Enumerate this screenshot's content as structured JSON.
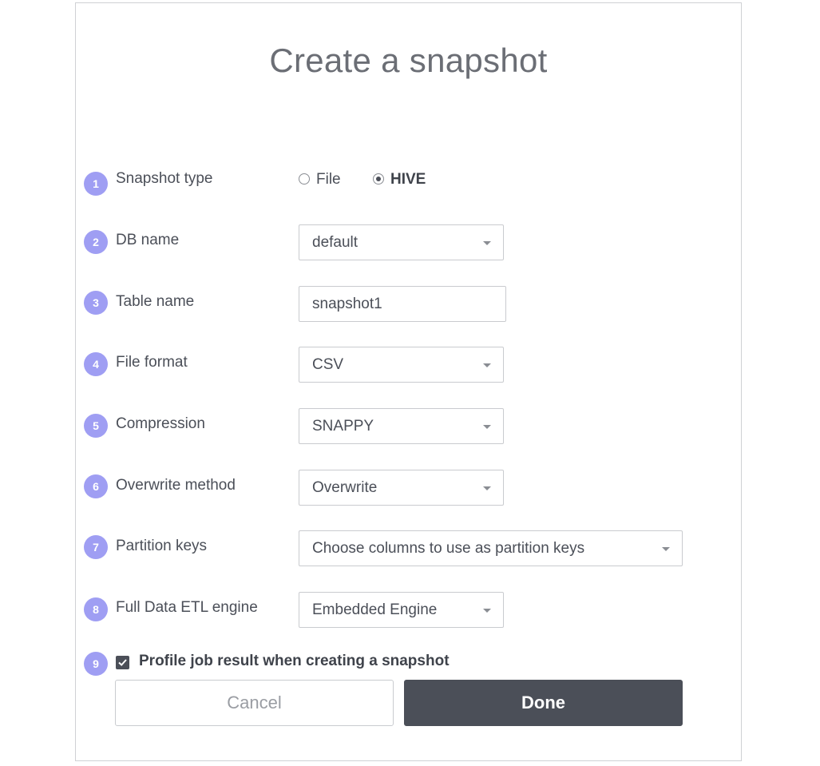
{
  "dialog": {
    "title": "Create a snapshot"
  },
  "fields": {
    "snapshot_type": {
      "number": "1",
      "label": "Snapshot type",
      "options": [
        "File",
        "HIVE"
      ],
      "selected": "HIVE"
    },
    "db_name": {
      "number": "2",
      "label": "DB name",
      "value": "default"
    },
    "table_name": {
      "number": "3",
      "label": "Table name",
      "value": "snapshot1"
    },
    "file_format": {
      "number": "4",
      "label": "File format",
      "value": "CSV"
    },
    "compression": {
      "number": "5",
      "label": "Compression",
      "value": "SNAPPY"
    },
    "overwrite_method": {
      "number": "6",
      "label": "Overwrite method",
      "value": "Overwrite"
    },
    "partition_keys": {
      "number": "7",
      "label": "Partition keys",
      "placeholder": "Choose columns to use as partition keys"
    },
    "etl_engine": {
      "number": "8",
      "label": "Full Data ETL engine",
      "value": "Embedded Engine"
    },
    "profile_job": {
      "number": "9",
      "label": "Profile job result when creating a snapshot",
      "checked": true
    }
  },
  "buttons": {
    "cancel": "Cancel",
    "done": "Done"
  },
  "colors": {
    "badge": "#9f9ef3",
    "primary_button": "#4b4f58",
    "border": "#c9cbcf"
  }
}
